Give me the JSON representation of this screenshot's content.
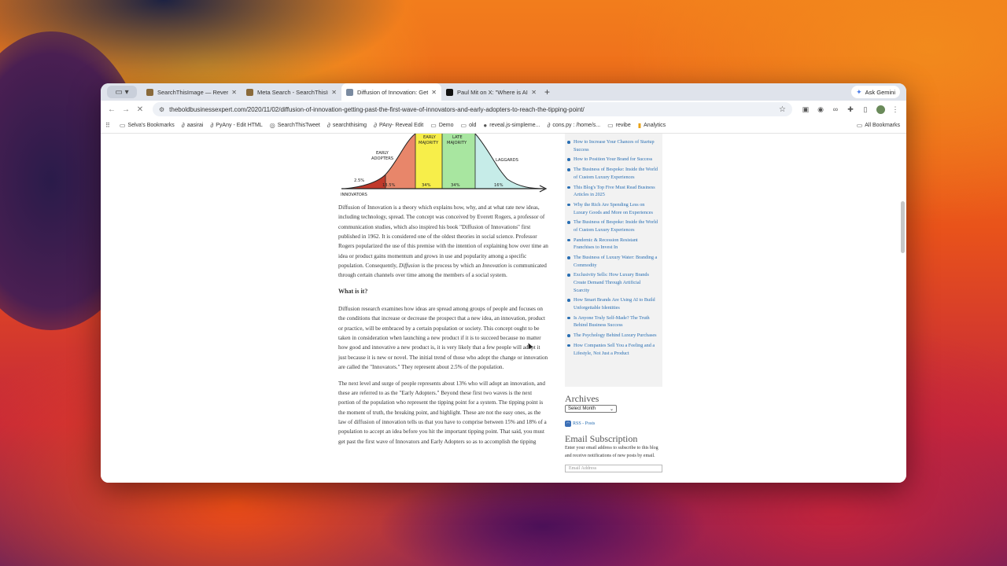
{
  "browser": {
    "tabs": [
      {
        "title": "SearchThisImage — Reverse",
        "favicon_color": "#8a6a3a",
        "active": false
      },
      {
        "title": "Meta Search - SearchThisIma",
        "favicon_color": "#8a6a3a",
        "active": false
      },
      {
        "title": "Diffusion of Innovation: Getti",
        "favicon_color": "#7a8aa0",
        "active": true
      },
      {
        "title": "Paul Mit on X: \"Where is AI t",
        "favicon_color": "#111111",
        "active": false
      }
    ],
    "new_tab_label": "+",
    "ask_gemini": "Ask Gemini",
    "url": "theboldbusinessexpert.com/2020/11/02/diffusion-of-innovation-getting-past-the-first-wave-of-innovators-and-early-adopters-to-reach-the-tipping-point/",
    "bookmarks": [
      {
        "label": "Selva's Bookmarks",
        "icon": "folder-icon"
      },
      {
        "label": "aasirai",
        "icon": "link-icon"
      },
      {
        "label": "PyAny - Edit HTML",
        "icon": "link-icon"
      },
      {
        "label": "SearchThisTweet",
        "icon": "globe-icon"
      },
      {
        "label": "searchthisimg",
        "icon": "link-icon"
      },
      {
        "label": "PAny- Reveal Edit",
        "icon": "link-icon"
      },
      {
        "label": "Demo",
        "icon": "folder-icon"
      },
      {
        "label": "old",
        "icon": "folder-icon"
      },
      {
        "label": "reveal.js-simpleme...",
        "icon": "github-icon"
      },
      {
        "label": "cons.py : /home/s...",
        "icon": "link-icon"
      },
      {
        "label": "revibe",
        "icon": "folder-icon"
      },
      {
        "label": "Analytics",
        "icon": "analytics-icon"
      }
    ],
    "all_bookmarks": "All Bookmarks"
  },
  "diagram": {
    "labels": {
      "innovators": "INNOVATORS",
      "early_adopters": "EARLY ADOPTERS",
      "early_majority": "EARLY MAJORITY",
      "late_majority": "LATE MAJORITY",
      "laggards": "LAGGARDS"
    },
    "percents": {
      "innovators": "2.5%",
      "early_adopters": "13.5%",
      "early_majority": "34%",
      "late_majority": "34%",
      "laggards": "16%"
    },
    "colors": {
      "innovators": "#c0392b",
      "early_adopters": "#e8866a",
      "early_majority": "#f7ee4a",
      "late_majority": "#a8e6a0",
      "laggards": "#c6ece8"
    }
  },
  "article": {
    "para1_a": "Diffusion of Innovation is a theory which explains how, why, and at what rate new ideas, including technology, spread. The concept was conceived by Everett Rogers, a professor of communication studies, which also inspired his book \"Diffusion of Innovations\" first published in 1962. It is considered one of the oldest theories in social science. Professor Rogers popularized the use of this premise with the intention of explaining how over time an idea or product gains momentum and grows in use and popularity among a specific population. Consequently, ",
    "para1_em1": "Diffusion",
    "para1_b": " is the process by which an ",
    "para1_em2": "Innovation",
    "para1_c": " is communicated through certain channels over time among the members of a social system.",
    "heading": "What is it?",
    "para2": "Diffusion research examines how ideas are spread among groups of people and focuses on the conditions that increase or decrease the prospect that a new idea, an innovation, product or practice, will be embraced by a certain population or society.  This concept ought to be taken in consideration when launching a new product if it is to succeed because no matter how good and innovative a new product is, it is very likely that a few people will adopt it just because it is new or novel.  The initial trend of those who adopt the change or innovation are called the \"Innovators.\" They represent about 2.5% of the population.",
    "para3": "The next level and surge of people represents about 13% who will adopt an innovation, and these are referred to as the \"Early Adopters.\" Beyond these first two waves is the next portion of the population who represent the tipping point for a system. The tipping point is the moment of truth, the breaking point, and highlight. These are not the easy ones, as the law of diffusion of innovation tells us that you have to comprise between 15% and 18% of a population to accept an idea before you hit the important tipping point. That said, you must get past the first wave of Innovators and Early Adopters so as to accomplish the tipping"
  },
  "sidebar": {
    "posts": [
      "How to Increase Your Chances of Startup Success",
      "How to Position Your Brand for Success",
      "The Business of Bespoke: Inside the World of Custom Luxury Experiences",
      "This Blog's Top Five Must Read Business Articles in 2025",
      "Why the Rich Are Spending Less on Luxury Goods and More on Experiences",
      "The Business of Bespoke: Inside the World of Custom Luxury Experiences",
      "Pandemic & Recession Resistant Franchises to Invest In",
      "The Business of Luxury Water: Branding a Commodity",
      "Exclusivity Sells: How Luxury Brands Create Demand Through Artificial Scarcity",
      "How Smart Brands Are Using AI to Build Unforgettable Identities",
      "Is Anyone Truly Self-Made? The Truth Behind Business Success",
      "The Psychology Behind Luxury Purchases",
      "How Companies Sell You a Feeling and a Lifestyle, Not Just a Product"
    ],
    "archives_heading": "Archives",
    "archives_select": "Select Month",
    "rss_label": "RSS - Posts",
    "email_heading": "Email Subscription",
    "email_text": "Enter your email address to subscribe to this blog and receive notifications of new posts by email.",
    "email_placeholder": "Email Address"
  }
}
